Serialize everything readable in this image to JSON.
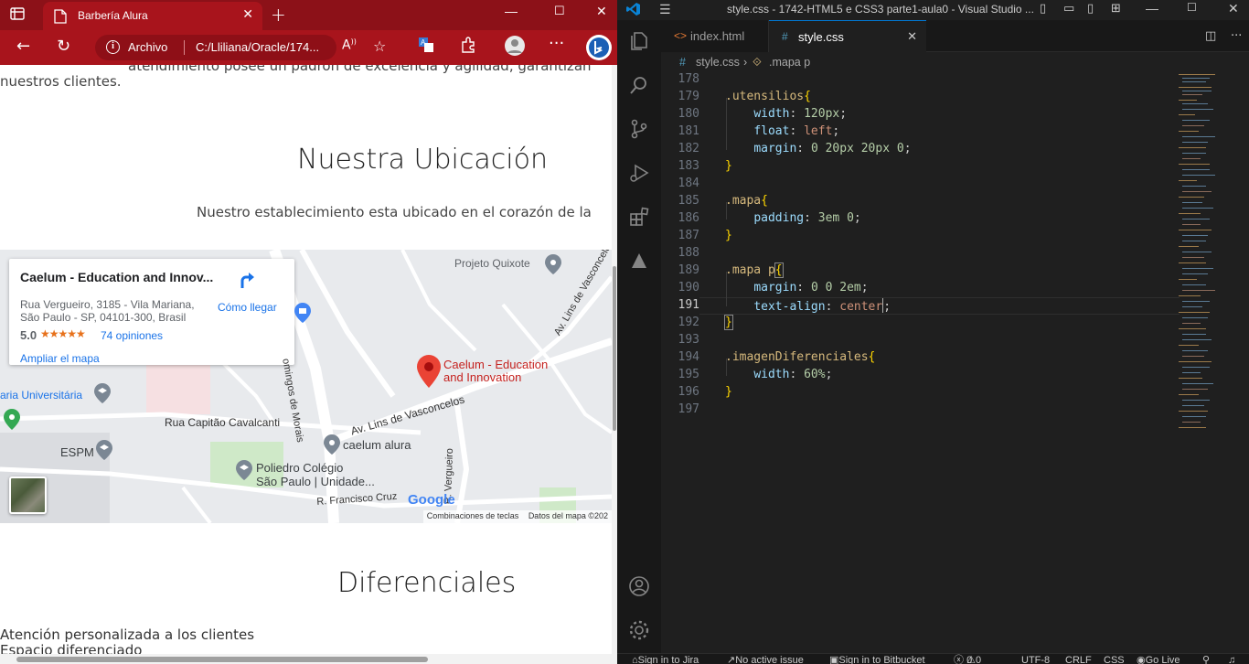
{
  "browser": {
    "tab_title": "Barbería Alura",
    "nav": {
      "archivo_label": "Archivo",
      "url": "C:/Lliliana/Oracle/174..."
    },
    "page": {
      "intro_line1": "atendimiento posee un padrón de excelencia y agilidad, garantizan",
      "intro_line2": "nuestros clientes.",
      "ubicacion_title": "Nuestra Ubicación",
      "ubicacion_text": "Nuestro establecimiento esta ubicado en el corazón de la",
      "diferenciales_title": "Diferenciales",
      "list_item1": "Atención personalizada a los clientes",
      "list_item2": "Espacio diferenciado"
    },
    "map": {
      "place_name": "Caelum - Education and Innov...",
      "address_line1": "Rua Vergueiro, 3185 - Vila Mariana,",
      "address_line2": "São Paulo - SP, 04101-300, Brasil",
      "rating": "5.0",
      "stars": "★★★★★",
      "reviews": "74 opiniones",
      "directions": "Cómo llegar",
      "enlarge": "Ampliar el mapa",
      "labels": {
        "projeto_quixote": "Projeto Quixote",
        "marker_line1": "Caelum - Education",
        "marker_line2": "and Innovation",
        "av_lins_v": "Av. Lins de Vasconcelos",
        "av_lins_h": "Av. Lins de Vasconcelos",
        "domingos": "omingos de Morais",
        "aria": "aria Universitária",
        "rua_capitao": "Rua Capitão Cavalcanti",
        "caelum_alura": "caelum alura",
        "espm": "ESPM",
        "poliedro1": "Poliedro Colégio",
        "poliedro2": "São Paulo | Unidade...",
        "rua_vergueiro": "R. Vergueiro",
        "francisco": "R. Francisco Cruz",
        "google": "Google"
      },
      "footer_shortcuts": "Combinaciones de teclas",
      "footer_data": "Datos del mapa ©202"
    }
  },
  "vscode": {
    "window_title": "style.css - 1742-HTML5 e CSS3 parte1-aula0 - Visual Studio ...",
    "tabs": [
      {
        "name": "index.html"
      },
      {
        "name": "style.css"
      }
    ],
    "breadcrumb": {
      "file": "style.css",
      "symbol": ".mapa p"
    },
    "lines": [
      {
        "n": "178"
      },
      {
        "n": "179"
      },
      {
        "n": "180"
      },
      {
        "n": "181"
      },
      {
        "n": "182"
      },
      {
        "n": "183"
      },
      {
        "n": "184"
      },
      {
        "n": "185"
      },
      {
        "n": "186"
      },
      {
        "n": "187"
      },
      {
        "n": "188"
      },
      {
        "n": "189"
      },
      {
        "n": "190"
      },
      {
        "n": "191"
      },
      {
        "n": "192"
      },
      {
        "n": "193"
      },
      {
        "n": "194"
      },
      {
        "n": "195"
      },
      {
        "n": "196"
      },
      {
        "n": "197"
      }
    ],
    "code": {
      "l179_sel": ".utensilios",
      "l180_prop": "width",
      "l180_val": "120px",
      "l181_prop": "float",
      "l181_val": "left",
      "l182_prop": "margin",
      "l182_val": "0 20px 20px 0",
      "l185_sel": ".mapa",
      "l186_prop": "padding",
      "l186_val": "3em 0",
      "l189_sel": ".mapa p",
      "l190_prop": "margin",
      "l190_val": "0 0 2em",
      "l191_prop": "text-align",
      "l191_val": "center",
      "l194_sel": ".imagenDiferenciales",
      "l195_prop": "width",
      "l195_val": "60%"
    },
    "status": {
      "jira": "Sign in to Jira",
      "issue": "No active issue",
      "bitbucket": "Sign in to Bitbucket",
      "errors": "0",
      "warnings": "0",
      "encoding": "UTF-8",
      "eol": "CRLF",
      "language": "CSS",
      "golive": "Go Live"
    }
  }
}
